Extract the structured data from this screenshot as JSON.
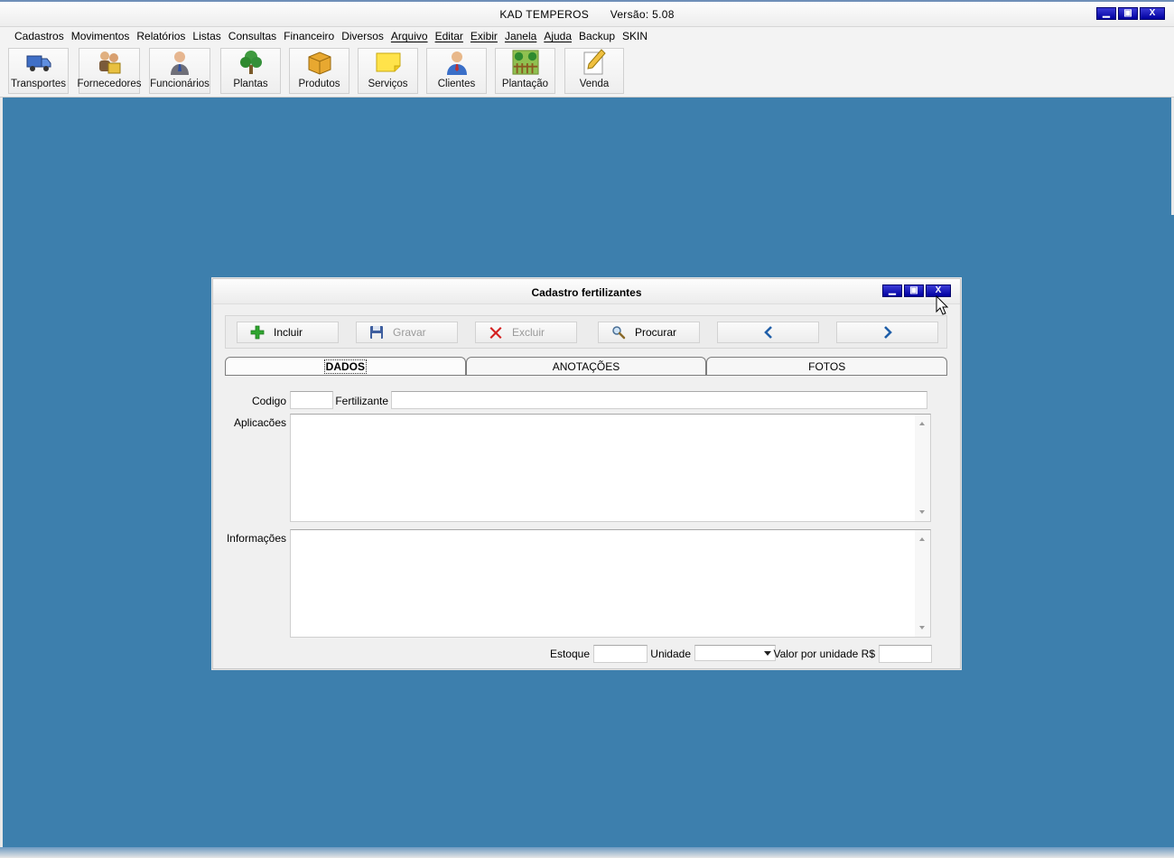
{
  "app": {
    "title_name": "KAD TEMPEROS",
    "title_version": "Versão: 5.08",
    "window_controls": {
      "minimize": "▁",
      "maximize": "▣",
      "close": "X"
    }
  },
  "menu": {
    "items": [
      {
        "label": "Cadastros",
        "underline": false
      },
      {
        "label": "Movimentos",
        "underline": false
      },
      {
        "label": "Relatórios",
        "underline": false
      },
      {
        "label": "Listas",
        "underline": false
      },
      {
        "label": "Consultas",
        "underline": false
      },
      {
        "label": "Financeiro",
        "underline": false
      },
      {
        "label": "Diversos",
        "underline": false
      },
      {
        "label": "Arquivo",
        "underline": true
      },
      {
        "label": "Editar",
        "underline": true
      },
      {
        "label": "Exibir",
        "underline": true
      },
      {
        "label": "Janela",
        "underline": true
      },
      {
        "label": "Ajuda",
        "underline": true
      },
      {
        "label": "Backup",
        "underline": false
      },
      {
        "label": "SKIN",
        "underline": false
      }
    ]
  },
  "toolbar": {
    "buttons": [
      {
        "label": "Transportes",
        "icon": "truck-icon"
      },
      {
        "label": "Fornecedores",
        "icon": "suppliers-icon"
      },
      {
        "label": "Funcionários",
        "icon": "employee-icon"
      },
      {
        "label": "Plantas",
        "icon": "tree-icon"
      },
      {
        "label": "Produtos",
        "icon": "box-icon"
      },
      {
        "label": "Serviços",
        "icon": "note-icon"
      },
      {
        "label": "Clientes",
        "icon": "client-icon"
      },
      {
        "label": "Plantação",
        "icon": "plantation-icon"
      },
      {
        "label": "Venda",
        "icon": "pencil-icon"
      }
    ]
  },
  "dialog": {
    "title": "Cadastro fertilizantes",
    "actions": {
      "incluir": "Incluir",
      "gravar": "Gravar",
      "excluir": "Excluir",
      "procurar": "Procurar"
    },
    "tabs": [
      "DADOS",
      "ANOTAÇÕES",
      "FOTOS"
    ],
    "fields": {
      "codigo_label": "Codigo",
      "codigo_value": "",
      "fertilizante_label": "Fertilizante",
      "fertilizante_value": "",
      "aplicacoes_label": "Aplicacões",
      "informacoes_label": "Informações",
      "estoque_label": "Estoque",
      "estoque_value": "",
      "unidade_label": "Unidade",
      "unidade_value": "",
      "valor_label": "Valor por unidade R$",
      "valor_value": ""
    }
  },
  "colors": {
    "desktop": "#3d7fad",
    "title_buttons": "#0000a0",
    "add": "#2fa52f",
    "delete": "#d42020",
    "nav_arrow": "#1f5ea8"
  }
}
